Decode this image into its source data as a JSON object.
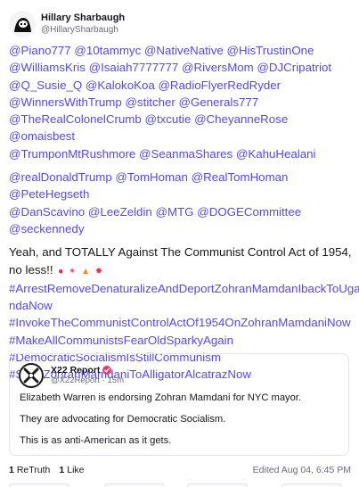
{
  "author": {
    "display_name": "Hillary Sharbaugh",
    "handle": "@HillarySharbaugh"
  },
  "mention_lines": [
    "@Piano777 @10tammyc @NativeNative @HisTrustinOne",
    "@WilliamsKris @Isaiah7777777 @RiversMom @DJCripatriot",
    "@Q_Susie_Q @KalokoKoa @RadioFlyerRedRyder",
    "@WinnersWithTrump @stitcher @Generals777",
    "@TheRealColonelCrumb @txcutie @CheyanneRose @omaisbest",
    "@TrumponMtRushmore @SeanmaShares @KahuHealani"
  ],
  "mention_lines_2": [
    "@realDonaldTrump @TomHoman @RealTomHoman @PeteHegseth",
    "@DanScavino  @LeeZeldin @MTG @DOGECommittee",
    "@seckennedy"
  ],
  "body_text_1": "Yeah, and TOTALLY Against The Communist Control Act of 1954,",
  "body_text_2": "no less!!",
  "emojis": [
    {
      "name": "angry-face-emoji",
      "glyph": "●",
      "color": "#e0245e"
    },
    {
      "name": "anger-symbol-emoji",
      "glyph": "✴",
      "color": "#e8305a"
    },
    {
      "name": "fire-emoji",
      "glyph": "▲",
      "color": "#f28b1e"
    },
    {
      "name": "collision-emoji",
      "glyph": "✸",
      "color": "#e8305a"
    }
  ],
  "hashtags": [
    "#ArrestRemoveDenaturalizeAndDeportZohranMamdanIbackToUga",
    "ndaNow",
    "#InvokeTheCommunistControlActOf1954OnZohranMamdaniNow",
    "#MakeAllCommunistsFearOldSparkyAgain",
    "#DemocraticSocialismIsStillCommunism",
    "#SendZohranMamdaniToAlligatorAlcatrazNow"
  ],
  "quote": {
    "name": "X22 Report",
    "handle": "@X22Report",
    "time": "15m",
    "paragraphs": [
      "Elizabeth Warren is endorsing Zohran Mamdani for NYC mayor.",
      "They are advocating for Democratic Socialism.",
      "This is as anti-American as it gets."
    ]
  },
  "footer": {
    "retruth_count": "1",
    "retruth_label": "ReTruth",
    "like_count": "1",
    "like_label": "Like",
    "edited": "Edited Aug 04, 6:45 PM"
  },
  "colors": {
    "link": "#5448ee",
    "verified_badge": "#e23d6e"
  }
}
